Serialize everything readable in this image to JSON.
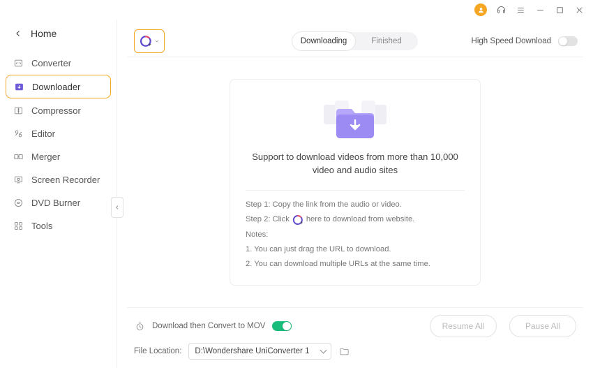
{
  "home_label": "Home",
  "sidebar": {
    "items": [
      {
        "label": "Converter",
        "icon": "converter-icon"
      },
      {
        "label": "Downloader",
        "icon": "downloader-icon"
      },
      {
        "label": "Compressor",
        "icon": "compressor-icon"
      },
      {
        "label": "Editor",
        "icon": "editor-icon"
      },
      {
        "label": "Merger",
        "icon": "merger-icon"
      },
      {
        "label": "Screen Recorder",
        "icon": "screen-recorder-icon"
      },
      {
        "label": "DVD Burner",
        "icon": "dvd-burner-icon"
      },
      {
        "label": "Tools",
        "icon": "tools-icon"
      }
    ],
    "active_index": 1
  },
  "tabs": {
    "downloading": "Downloading",
    "finished": "Finished",
    "active": "downloading"
  },
  "high_speed": {
    "label": "High Speed Download",
    "on": false
  },
  "empty_state": {
    "headline": "Support to download videos from more than 10,000 video and audio sites",
    "step1": "Step 1: Copy the link from the audio or video.",
    "step2_a": "Step 2: Click",
    "step2_b": "here to download from website.",
    "notes_heading": "Notes:",
    "note1": "1. You can just drag the URL to download.",
    "note2": "2. You can download multiple URLs at the same time."
  },
  "footer": {
    "convert_label": "Download then Convert to MOV",
    "convert_on": true,
    "file_location_label": "File Location:",
    "file_location_value": "D:\\Wondershare UniConverter 1",
    "resume_label": "Resume All",
    "pause_label": "Pause All"
  }
}
